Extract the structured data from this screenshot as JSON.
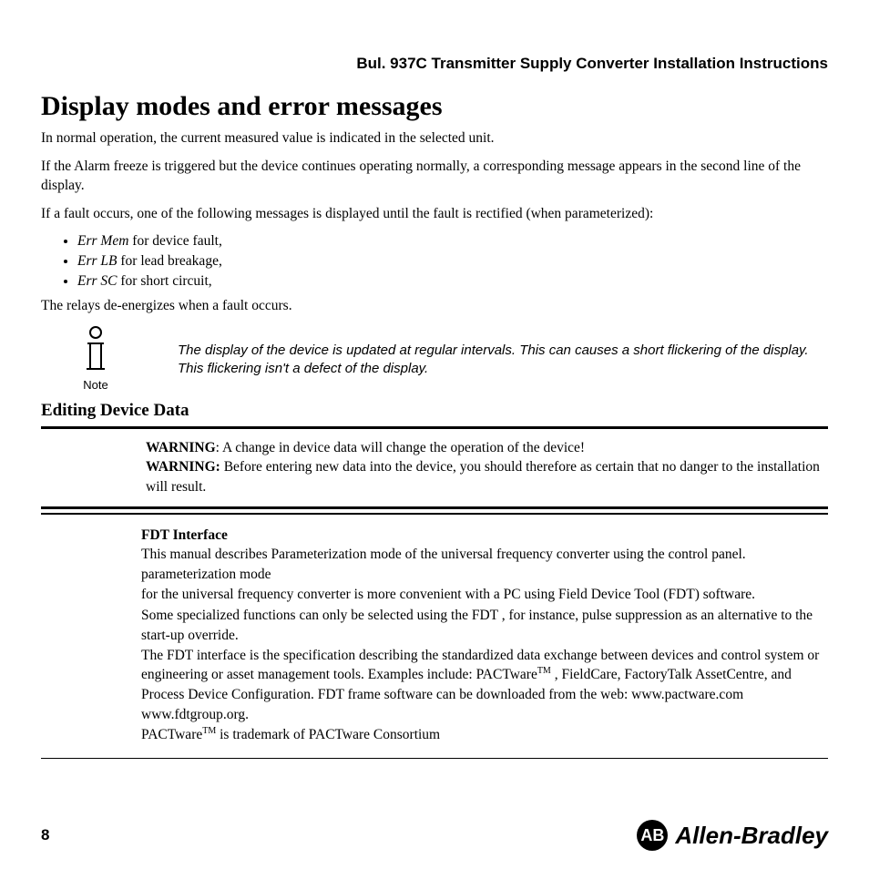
{
  "header": {
    "doc_title": "Bul. 937C Transmitter Supply Converter Installation Instructions"
  },
  "section": {
    "title": "Display modes and error messages",
    "p1": "In normal operation, the current measured value is indicated in the selected unit.",
    "p2": "If the Alarm freeze is triggered but the device continues operating normally, a corresponding message appears in the second line of the display.",
    "p3": "If a fault occurs, one of the following messages is displayed until the fault is rectified (when parameterized):",
    "errors": [
      {
        "code": "Err Mem",
        "desc": " for device fault,"
      },
      {
        "code": "Err LB",
        "desc": " for lead breakage,"
      },
      {
        "code": "Err SC",
        "desc": " for short circuit,"
      }
    ],
    "p4": "The relays de-energizes when a fault occurs.",
    "note_label": "Note",
    "note_text": "The display of the device is updated at regular intervals. This can causes a short flickering of the display. This flickering isn't a defect of the display."
  },
  "editing": {
    "title": "Editing Device Data",
    "warn1_label": "WARNING",
    "warn1_text": ": A change in device data will change the operation of the device!",
    "warn2_label": "WARNING:",
    "warn2_text": " Before entering new data into the device, you should therefore as certain that no danger to the installation will result."
  },
  "fdt": {
    "heading": "FDT Interface",
    "p1": "This manual describes Parameterization mode of the universal frequency converter using the control panel. parameterization mode",
    "p2": "for the universal frequency converter is more convenient with a PC using Field Device Tool (FDT) software.",
    "p3": "Some specialized functions can only be selected using the FDT , for instance, pulse suppression as an alternative to the start-up override.",
    "p4a": "The FDT interface is the specification describing the standardized data exchange between devices and control system or engineering or asset management tools. Examples include: PACTware",
    "p4b": " , FieldCare, FactoryTalk  AssetCentre, and Process Device Configuration.  FDT frame software can be downloaded from the web: www.pactware.com www.fdtgroup.org.",
    "p5a": "PACTware",
    "p5b": " is trademark of PACTware Consortium",
    "tm": "TM"
  },
  "footer": {
    "page": "8",
    "brand_initials": "AB",
    "brand_name": "Allen-Bradley"
  }
}
